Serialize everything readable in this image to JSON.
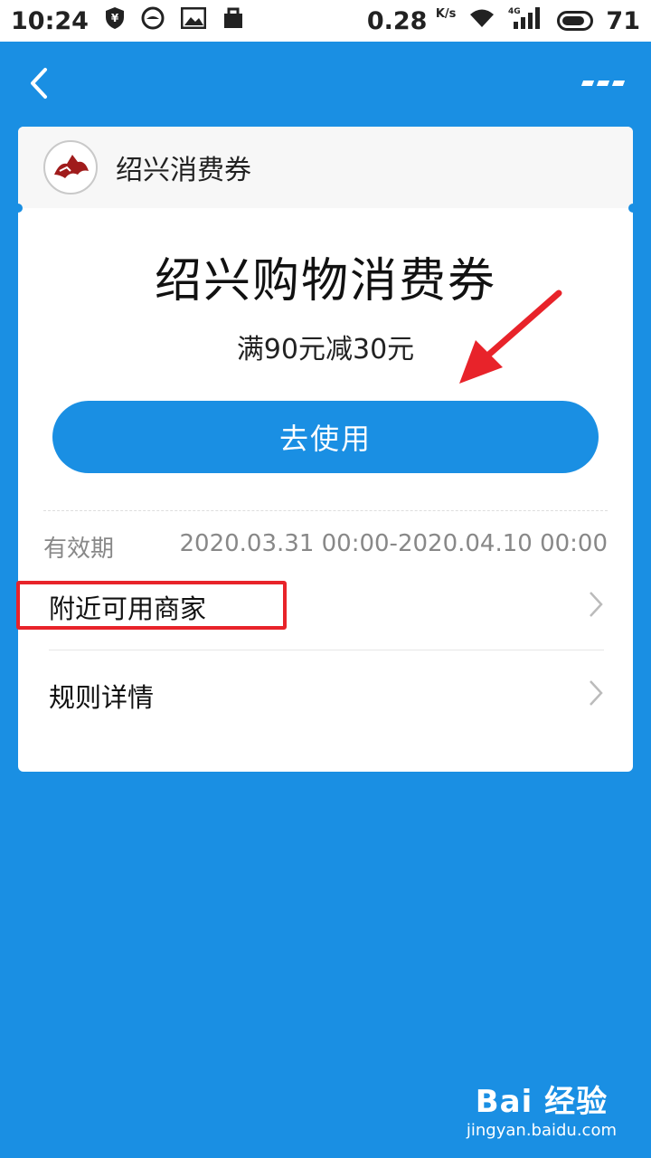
{
  "status_bar": {
    "time": "10:24",
    "speed": "0.28",
    "speed_unit": "K/s",
    "network": "4G",
    "battery": "71"
  },
  "icons": {
    "back": "back-icon",
    "more": "more-icon",
    "chevron": "chevron-right-icon"
  },
  "header": {
    "brand_name": "绍兴消费券"
  },
  "coupon": {
    "title": "绍兴购物消费券",
    "description": "满90元减30元",
    "use_button_label": "去使用"
  },
  "validity": {
    "label": "有效期",
    "value": "2020.03.31 00:00-2020.04.10 00:00"
  },
  "menu": {
    "items": [
      {
        "label": "附近可用商家"
      },
      {
        "label": "规则详情"
      }
    ]
  },
  "watermark": {
    "main": "Bai 经验",
    "sub": "jingyan.baidu.com"
  },
  "colors": {
    "primary": "#1a8fe3",
    "annotation_red": "#e8232a"
  }
}
